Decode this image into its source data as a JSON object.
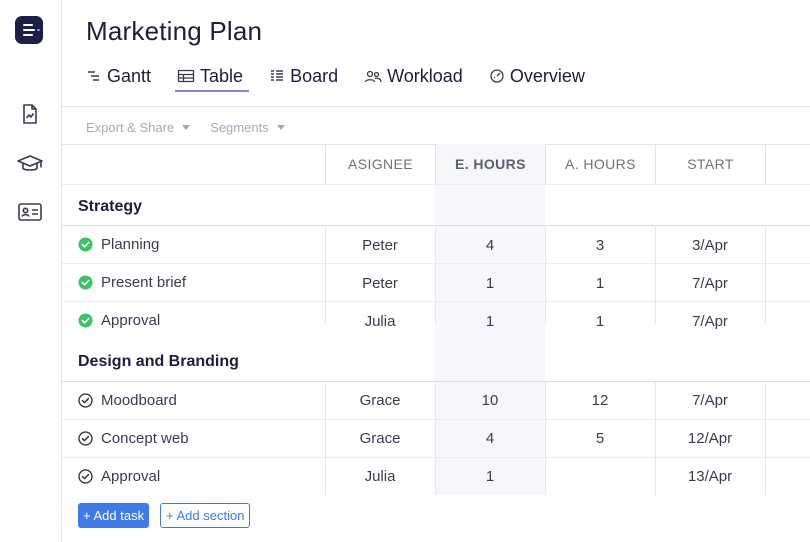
{
  "page": {
    "title": "Marketing Plan"
  },
  "sidebar": {
    "items": [
      {
        "icon": "document-chart-icon"
      },
      {
        "icon": "graduation-cap-icon"
      },
      {
        "icon": "contact-card-icon"
      }
    ]
  },
  "tabs": [
    {
      "label": "Gantt",
      "icon": "gantt-icon",
      "active": false
    },
    {
      "label": "Table",
      "icon": "table-icon",
      "active": true
    },
    {
      "label": "Board",
      "icon": "board-icon",
      "active": false
    },
    {
      "label": "Workload",
      "icon": "workload-icon",
      "active": false
    },
    {
      "label": "Overview",
      "icon": "overview-icon",
      "active": false
    }
  ],
  "toolbar": {
    "export": "Export & Share",
    "segments": "Segments"
  },
  "table": {
    "columns": [
      "ASIGNEE",
      "E. HOURS",
      "A. HOURS",
      "START"
    ],
    "sections": [
      {
        "name": "Strategy",
        "tasks": [
          {
            "name": "Planning",
            "done": true,
            "assignee": "Peter",
            "e_hours": "4",
            "a_hours": "3",
            "start": "3/Apr"
          },
          {
            "name": "Present brief",
            "done": true,
            "assignee": "Peter",
            "e_hours": "1",
            "a_hours": "1",
            "start": "7/Apr"
          },
          {
            "name": "Approval",
            "done": true,
            "assignee": "Julia",
            "e_hours": "1",
            "a_hours": "1",
            "start": "7/Apr"
          }
        ]
      },
      {
        "name": "Design and Branding",
        "tasks": [
          {
            "name": "Moodboard",
            "done": false,
            "assignee": "Grace",
            "e_hours": "10",
            "a_hours": "12",
            "start": "7/Apr"
          },
          {
            "name": "Concept web",
            "done": false,
            "assignee": "Grace",
            "e_hours": "4",
            "a_hours": "5",
            "start": "12/Apr"
          },
          {
            "name": "Approval",
            "done": false,
            "assignee": "Julia",
            "e_hours": "1",
            "a_hours": "",
            "start": "13/Apr"
          }
        ]
      }
    ]
  },
  "actions": {
    "add_task": "+ Add task",
    "add_section": "+ Add section"
  },
  "colors": {
    "accent": "#3e7be6",
    "done_green": "#3cc267",
    "brand": "#1d2046",
    "tab_underline": "#8c86d6"
  }
}
